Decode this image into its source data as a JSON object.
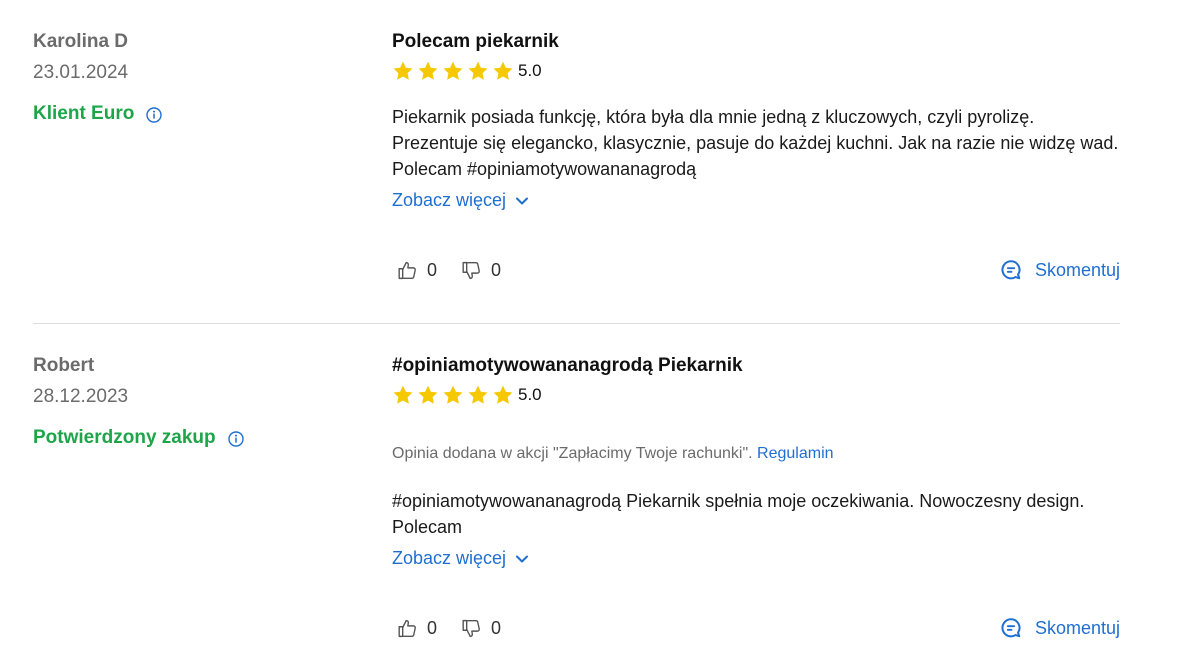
{
  "reviews": [
    {
      "author": "Karolina D",
      "date": "23.01.2024",
      "badge": "Klient Euro",
      "title": "Polecam piekarnik",
      "stars": 5,
      "rating": "5.0",
      "campaign_text": "",
      "campaign_link": "",
      "text": "Piekarnik posiada funkcję, która była dla mnie jedną z kluczowych, czyli pyrolizę. Prezentuje się elegancko, klasycznie, pasuje do każdej kuchni. Jak na razie nie widzę wad. Polecam #opiniamotywowananagrodą",
      "see_more": "Zobacz więcej",
      "likes": "0",
      "dislikes": "0",
      "comment": "Skomentuj"
    },
    {
      "author": "Robert",
      "date": "28.12.2023",
      "badge": "Potwierdzony zakup",
      "title": "#opiniamotywowananagrodą Piekarnik",
      "stars": 5,
      "rating": "5.0",
      "campaign_text": "Opinia dodana w akcji \"Zapłacimy Twoje rachunki\".",
      "campaign_link": "Regulamin",
      "text": "#opiniamotywowananagrodą Piekarnik spełnia moje oczekiwania. Nowoczesny design. Polecam",
      "see_more": "Zobacz więcej",
      "likes": "0",
      "dislikes": "0",
      "comment": "Skomentuj"
    }
  ],
  "colors": {
    "badge_green": "#1ea54a",
    "link_blue": "#1f6fd1",
    "star_yellow": "#f5c800",
    "muted_gray": "#6b6b6b"
  },
  "icons": [
    "info-icon",
    "star-icon",
    "chevron-down-icon",
    "thumbs-up-icon",
    "thumbs-down-icon",
    "comment-icon"
  ]
}
